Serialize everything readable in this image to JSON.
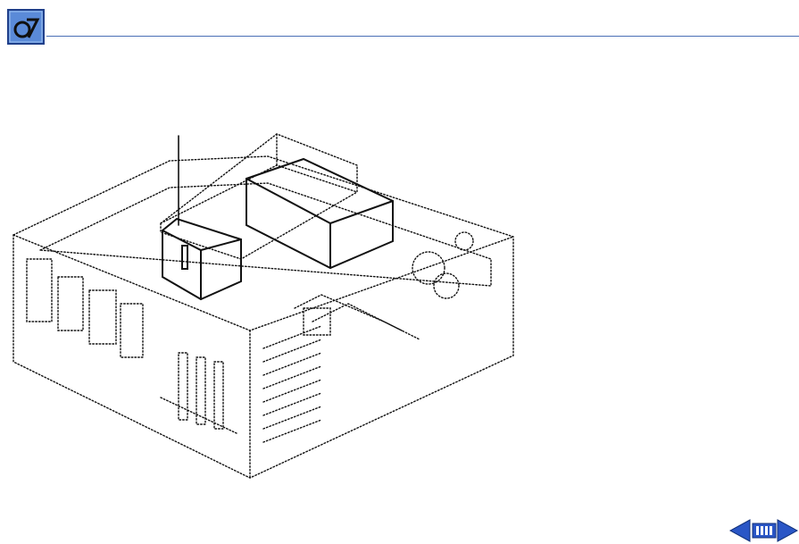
{
  "header": {
    "logo_icon": "mac-os-logo-icon",
    "rule_color": "#4a6fb5"
  },
  "illustration": {
    "subject": "exploded-cpu-chassis-icon",
    "callout_count": 1
  },
  "navigation": {
    "prev_icon": "arrow-left-icon",
    "index_icon": "index-bars-icon",
    "next_icon": "arrow-right-icon",
    "accent_color": "#2a56c6"
  }
}
